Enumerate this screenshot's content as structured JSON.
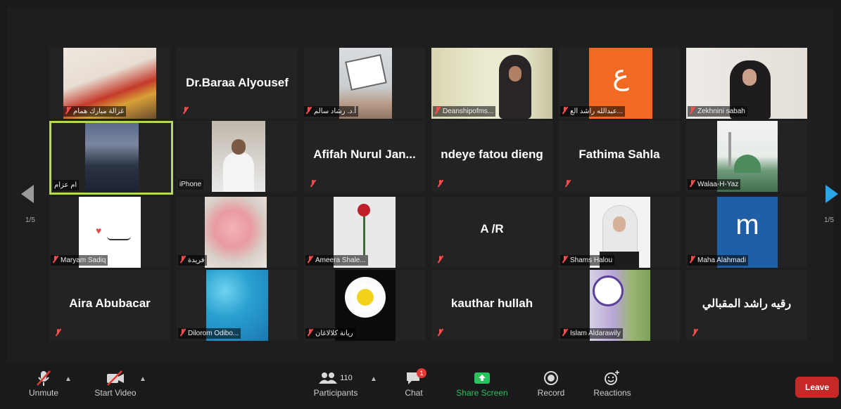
{
  "pager": {
    "left": "1/5",
    "right": "1/5"
  },
  "tiles": {
    "r1c1": "غزالة مبارك همام",
    "r1c2": "Dr.Baraa Alyousef",
    "r1c3": "أ.د. رشاد سالم",
    "r1c4": "Deanshipofms...",
    "r1c5": "عبدالله راشد الع...",
    "r1c5_logo": "ع",
    "r1c6": "Zekhnini sabah",
    "r2c1": "ام عزام",
    "r2c2": "iPhone",
    "r2c3": "Afifah Nurul Jan...",
    "r2c4": "ndeye fatou dieng",
    "r2c5": "Fathima Sahla",
    "r2c6": "Walaa-H-Yaz",
    "r3c1": "Maryam Sadiq",
    "r3c2": "فريدة",
    "r3c3": "Ameera Shale...",
    "r3c4": "A /R",
    "r3c5": "Shams Halou",
    "r3c6": "Maha Alahmadi",
    "r3c6_logo": "m",
    "r4c1": "Aira Abubacar",
    "r4c2": "Dilorom Odibo...",
    "r4c3": "ريانة كلالاغان",
    "r4c4": "kauthar hullah",
    "r4c5": "Islam Aldarawily",
    "r4c6": "رقيه راشد المقبالي"
  },
  "toolbar": {
    "unmute": "Unmute",
    "start_video": "Start Video",
    "participants": "Participants",
    "participants_count": "110",
    "chat": "Chat",
    "chat_badge": "1",
    "share_screen": "Share Screen",
    "record": "Record",
    "reactions": "Reactions",
    "leave": "Leave"
  },
  "colors": {
    "accent_green": "#22c55e",
    "leave_red": "#c62828",
    "active_border": "#b6d85a",
    "arrow_blue": "#2aa6e8"
  }
}
